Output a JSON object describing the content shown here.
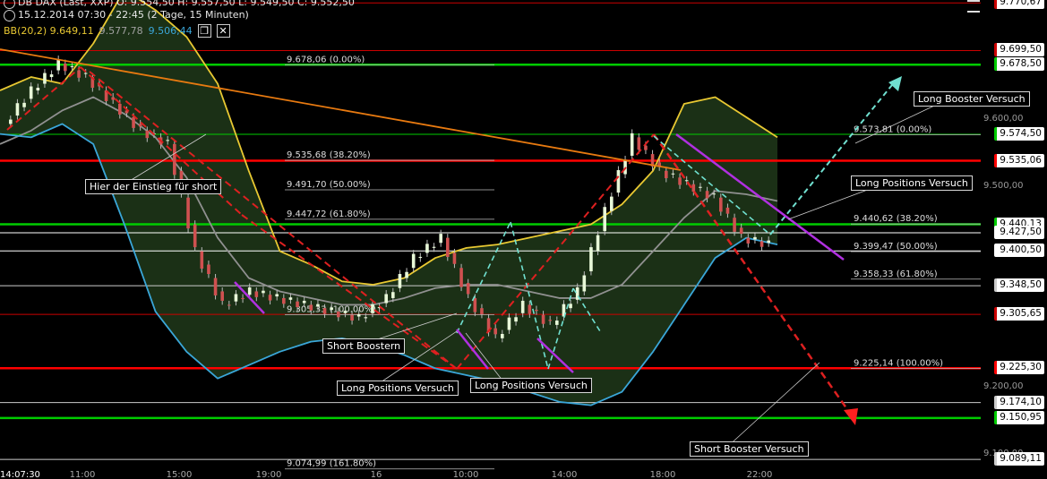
{
  "header": {
    "line1": "DB DAX (Last, XXP)  O: 9.554,50  H: 9.557,50  L: 9.549,50  C: 9.552,50",
    "line2": "15.12.2014 07:30 - 22:45 (2 Tage, 15 Minuten)",
    "bb_label": "BB(20,2)  9.649,11",
    "bb_mid": "9.577,78",
    "bb_low": "9.506,44"
  },
  "chart_data": {
    "type": "line",
    "title": "DB DAX (Last, XXP)",
    "x_ticks": [
      "11:00",
      "15:00",
      "19:00",
      "16",
      "10:00",
      "14:00",
      "18:00",
      "22:00"
    ],
    "y_ticks": [
      "9.600,00",
      "9.500,00",
      "9.200,00",
      "9.100,00"
    ],
    "y_range": [
      9080,
      9775
    ],
    "start_time": "14:07:30",
    "price_labels": [
      {
        "text": "9.770,67",
        "value": 9770.67,
        "color": "#cc0000"
      },
      {
        "text": "9.699,50",
        "value": 9699.5,
        "color": "#cc0000"
      },
      {
        "text": "9.678,50",
        "value": 9678.5,
        "color": "#00cc00"
      },
      {
        "text": "9.574,50",
        "value": 9574.5,
        "color": "#00cc00"
      },
      {
        "text": "9.535,06",
        "value": 9535.06,
        "color": "#ff0000"
      },
      {
        "text": "9.440,13",
        "value": 9440.13,
        "color": "#00cc00"
      },
      {
        "text": "9.427,50",
        "value": 9427.5,
        "color": "#ffffff"
      },
      {
        "text": "9.400,50",
        "value": 9400.5,
        "color": "#ffffff"
      },
      {
        "text": "9.348,50",
        "value": 9348.5,
        "color": "#cccccc"
      },
      {
        "text": "9.305,65",
        "value": 9305.65,
        "color": "#cc0000"
      },
      {
        "text": "9.225,30",
        "value": 9225.3,
        "color": "#ff0000"
      },
      {
        "text": "9.174,10",
        "value": 9174.1,
        "color": "#cccccc"
      },
      {
        "text": "9.150,95",
        "value": 9150.95,
        "color": "#00cc00"
      },
      {
        "text": "9.089,11",
        "value": 9089.11,
        "color": "#cccccc"
      }
    ],
    "fib_left": [
      {
        "text": "9.678,06 (0.00%)",
        "value": 9678.06
      },
      {
        "text": "9.535,68 (38.20%)",
        "value": 9535.68
      },
      {
        "text": "9.491,70 (50.00%)",
        "value": 9491.7
      },
      {
        "text": "9.447,72 (61.80%)",
        "value": 9447.72
      },
      {
        "text": "9.305,33 (100.00%)",
        "value": 9305.33
      },
      {
        "text": "9.074,99 (161.80%)",
        "value": 9074.99
      }
    ],
    "fib_right": [
      {
        "text": "9.573,81 (0.00%)",
        "value": 9573.81
      },
      {
        "text": "9.440,62 (38.20%)",
        "value": 9440.62
      },
      {
        "text": "9.399,47 (50.00%)",
        "value": 9399.47
      },
      {
        "text": "9.358,33 (61.80%)",
        "value": 9358.33
      },
      {
        "text": "9.225,14 (100.00%)",
        "value": 9225.14
      }
    ],
    "annotations": [
      "Hier der Einstieg für short",
      "Short Boostern",
      "Long Positions Versuch",
      "Long Positions Versuch",
      "Long Booster Versuch",
      "Long Positions Versuch",
      "Short Booster Versuch"
    ],
    "series": [
      {
        "name": "BB(20,2)",
        "color": "#e8c832",
        "values": [
          9640,
          9660,
          9650,
          9710,
          9790,
          9760,
          9720,
          9650,
          9520,
          9400,
          9380,
          9355,
          9350,
          9360,
          9390,
          9405,
          9410,
          9420,
          9430,
          9440,
          9470,
          9520,
          9620,
          9630,
          9600,
          9570
        ]
      },
      {
        "name": "",
        "color": "#909090",
        "values": [
          9560,
          9580,
          9610,
          9630,
          9605,
          9570,
          9510,
          9420,
          9360,
          9340,
          9330,
          9320,
          9320,
          9330,
          9345,
          9350,
          9350,
          9340,
          9330,
          9330,
          9350,
          9400,
          9450,
          9490,
          9485,
          9475
        ]
      },
      {
        "name": "",
        "color": "#3aa6d8",
        "values": [
          9575,
          9570,
          9590,
          9560,
          9440,
          9310,
          9250,
          9210,
          9230,
          9250,
          9265,
          9270,
          9260,
          9245,
          9225,
          9215,
          9205,
          9190,
          9175,
          9170,
          9190,
          9250,
          9320,
          9390,
          9420,
          9410
        ]
      }
    ],
    "close": [
      9590,
      9640,
      9680,
      9660,
      9620,
      9580,
      9560,
      9400,
      9320,
      9340,
      9330,
      9320,
      9310,
      9300,
      9330,
      9390,
      9420,
      9330,
      9270,
      9320,
      9290,
      9340,
      9460,
      9570,
      9520,
      9500,
      9480,
      9420,
      9410
    ]
  }
}
